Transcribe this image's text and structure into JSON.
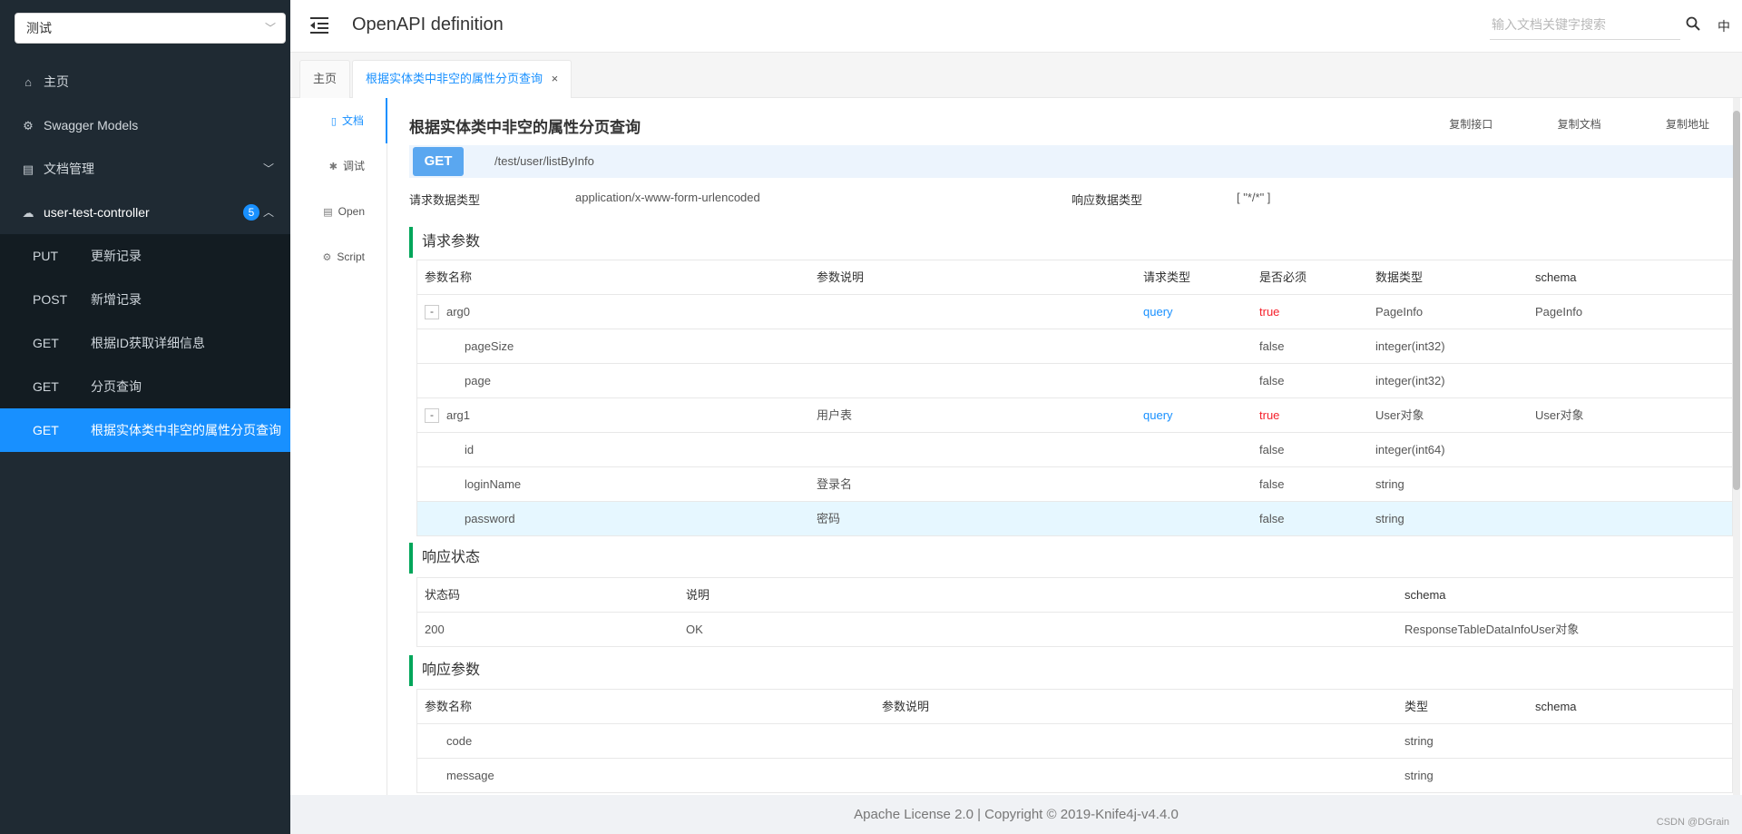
{
  "sidebar": {
    "group_select": "测试",
    "items": [
      {
        "label": "主页",
        "icon": "home-icon"
      },
      {
        "label": "Swagger Models",
        "icon": "gear-icon"
      },
      {
        "label": "文档管理",
        "icon": "file-icon"
      }
    ],
    "controller": {
      "label": "user-test-controller",
      "badge": "5",
      "icon": "cloud-icon"
    },
    "apis": [
      {
        "method": "PUT",
        "label": "更新记录"
      },
      {
        "method": "POST",
        "label": "新增记录"
      },
      {
        "method": "GET",
        "label": "根据ID获取详细信息"
      },
      {
        "method": "GET",
        "label": "分页查询"
      },
      {
        "method": "GET",
        "label": "根据实体类中非空的属性分页查询"
      }
    ]
  },
  "header": {
    "title": "OpenAPI definition",
    "search_placeholder": "输入文档关键字搜索",
    "lang": "中"
  },
  "tabs": {
    "home": "主页",
    "active": "根据实体类中非空的属性分页查询",
    "close": "×"
  },
  "vnav": {
    "doc": "文档",
    "debug": "调试",
    "open": "Open",
    "script": "Script"
  },
  "api": {
    "title": "根据实体类中非空的属性分页查询",
    "copy_api": "复制接口",
    "copy_doc": "复制文档",
    "copy_url": "复制地址",
    "method": "GET",
    "url": "/test/user/listByInfo",
    "req_type_label": "请求数据类型",
    "req_type": "application/x-www-form-urlencoded",
    "resp_type_label": "响应数据类型",
    "resp_type": "[ \"*/*\" ]"
  },
  "req_params": {
    "title": "请求参数",
    "headers": {
      "name": "参数名称",
      "desc": "参数说明",
      "in": "请求类型",
      "required": "是否必须",
      "type": "数据类型",
      "schema": "schema"
    },
    "rows": [
      {
        "expander": "-",
        "name": "arg0",
        "desc": "",
        "in": "query",
        "required": "true",
        "type": "PageInfo",
        "schema": "PageInfo"
      },
      {
        "expander": "",
        "name": "pageSize",
        "desc": "",
        "in": "",
        "required": "false",
        "type": "integer(int32)",
        "schema": ""
      },
      {
        "expander": "",
        "name": "page",
        "desc": "",
        "in": "",
        "required": "false",
        "type": "integer(int32)",
        "schema": ""
      },
      {
        "expander": "-",
        "name": "arg1",
        "desc": "用户表",
        "in": "query",
        "required": "true",
        "type": "User对象",
        "schema": "User对象"
      },
      {
        "expander": "",
        "name": "id",
        "desc": "",
        "in": "",
        "required": "false",
        "type": "integer(int64)",
        "schema": ""
      },
      {
        "expander": "",
        "name": "loginName",
        "desc": "登录名",
        "in": "",
        "required": "false",
        "type": "string",
        "schema": ""
      },
      {
        "expander": "",
        "name": "password",
        "desc": "密码",
        "in": "",
        "required": "false",
        "type": "string",
        "schema": ""
      }
    ]
  },
  "resp_status": {
    "title": "响应状态",
    "headers": {
      "code": "状态码",
      "desc": "说明",
      "schema": "schema"
    },
    "rows": [
      {
        "code": "200",
        "desc": "OK",
        "schema": "ResponseTableDataInfoUser对象"
      }
    ]
  },
  "resp_params": {
    "title": "响应参数",
    "headers": {
      "name": "参数名称",
      "desc": "参数说明",
      "type": "类型",
      "schema": "schema"
    },
    "rows": [
      {
        "name": "code",
        "desc": "",
        "type": "string",
        "schema": ""
      },
      {
        "name": "message",
        "desc": "",
        "type": "string",
        "schema": ""
      }
    ]
  },
  "footer": {
    "text": "Apache License 2.0 | Copyright © 2019-Knife4j-v4.4.0"
  },
  "watermark": "CSDN @DGrain"
}
